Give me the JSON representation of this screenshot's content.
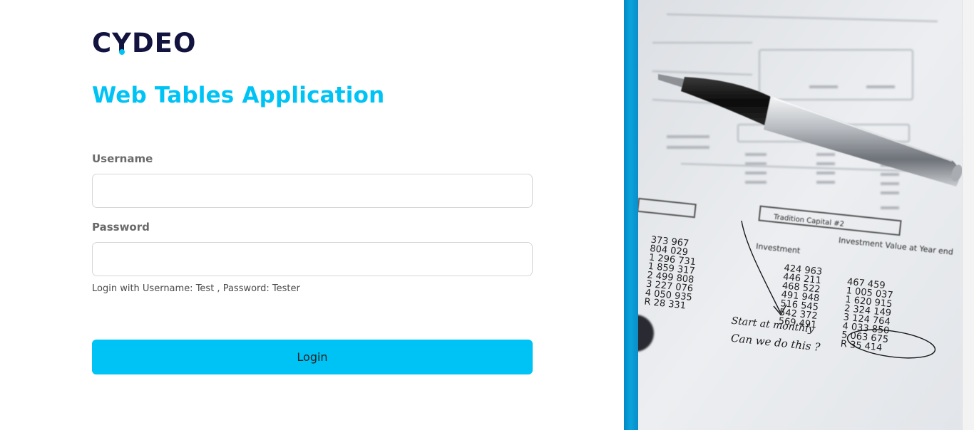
{
  "brand": {
    "logo_prefix": "C",
    "logo_y": "Y",
    "logo_suffix": "DEO",
    "accent_color": "#00c3f5",
    "dark_color": "#131340"
  },
  "page_title": "Web Tables Application",
  "form": {
    "username_label": "Username",
    "username_value": "",
    "password_label": "Password",
    "password_value": "",
    "hint": "Login with Username: Test , Password: Tester",
    "login_label": "Login"
  },
  "photo": {
    "subject": "financial document with pen",
    "headings": [
      "Investment",
      "Investment Value at Year end",
      "Tradition Capital #2"
    ],
    "column_1": [
      "373 967",
      "804 029",
      "1 296 731",
      "1 859 317",
      "2 499 808",
      "3 227 076",
      "4 050 935",
      "R 28 331"
    ],
    "column_2": [
      "424 963",
      "446 211",
      "468 522",
      "491 948",
      "516 545",
      "542 372",
      "569 491"
    ],
    "column_3": [
      "467 459",
      "1 005 037",
      "1 620 915",
      "2 324 149",
      "3 124 764",
      "4 033 850",
      "5 063 675",
      "R 35 414"
    ],
    "handwriting_1": "Start at monthly",
    "handwriting_2": "Can we do this ?"
  }
}
